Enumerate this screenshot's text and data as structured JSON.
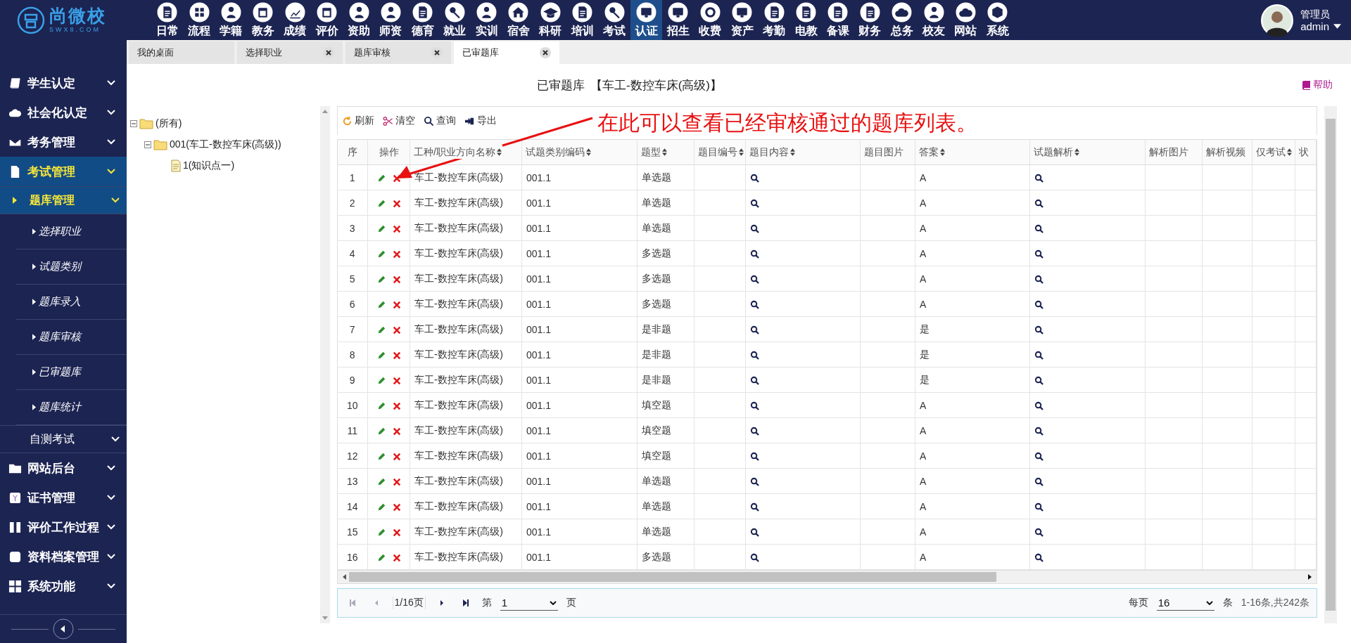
{
  "logo": {
    "name": "尚微校",
    "domain": "SWX8.COM"
  },
  "nav": [
    {
      "label": "日常",
      "selected": false
    },
    {
      "label": "流程",
      "selected": false
    },
    {
      "label": "学籍",
      "selected": false
    },
    {
      "label": "教务",
      "selected": false
    },
    {
      "label": "成绩",
      "selected": false
    },
    {
      "label": "评价",
      "selected": false
    },
    {
      "label": "资助",
      "selected": false
    },
    {
      "label": "师资",
      "selected": false
    },
    {
      "label": "德育",
      "selected": false
    },
    {
      "label": "就业",
      "selected": false
    },
    {
      "label": "实训",
      "selected": false
    },
    {
      "label": "宿舍",
      "selected": false
    },
    {
      "label": "科研",
      "selected": false
    },
    {
      "label": "培训",
      "selected": false
    },
    {
      "label": "考试",
      "selected": false
    },
    {
      "label": "认证",
      "selected": true
    },
    {
      "label": "招生",
      "selected": false
    },
    {
      "label": "收费",
      "selected": false
    },
    {
      "label": "资产",
      "selected": false
    },
    {
      "label": "考勤",
      "selected": false
    },
    {
      "label": "电教",
      "selected": false
    },
    {
      "label": "备课",
      "selected": false
    },
    {
      "label": "财务",
      "selected": false
    },
    {
      "label": "总务",
      "selected": false
    },
    {
      "label": "校友",
      "selected": false
    },
    {
      "label": "网站",
      "selected": false
    },
    {
      "label": "系统",
      "selected": false
    }
  ],
  "user": {
    "role": "管理员",
    "name": "admin"
  },
  "tabs": [
    {
      "label": "我的桌面",
      "closable": false,
      "selected": false
    },
    {
      "label": "选择职业",
      "closable": true,
      "selected": false
    },
    {
      "label": "题库审核",
      "closable": true,
      "selected": false
    },
    {
      "label": "已审题库",
      "closable": true,
      "selected": true
    }
  ],
  "sidebar": {
    "items": [
      {
        "label": "学生认定",
        "selected": false
      },
      {
        "label": "社会化认定",
        "selected": false
      },
      {
        "label": "考务管理",
        "selected": false
      },
      {
        "label": "考试管理",
        "selected": true,
        "children": [
          {
            "label": "题库管理",
            "selected": true,
            "children": [
              {
                "label": "选择职业"
              },
              {
                "label": "试题类别"
              },
              {
                "label": "题库录入"
              },
              {
                "label": "题库审核"
              },
              {
                "label": "已审题库"
              },
              {
                "label": "题库统计"
              }
            ]
          },
          {
            "label": "自测考试",
            "selected": false
          }
        ]
      },
      {
        "label": "网站后台",
        "selected": false
      },
      {
        "label": "证书管理",
        "selected": false
      },
      {
        "label": "评价工作过程",
        "selected": false
      },
      {
        "label": "资料档案管理",
        "selected": false
      },
      {
        "label": "系统功能",
        "selected": false
      }
    ]
  },
  "page": {
    "title": "已审题库",
    "subtitle": "【车工-数控车床(高级)】",
    "help": "帮助"
  },
  "tree": [
    {
      "label": "(所有)",
      "children": [
        {
          "label": "001(车工-数控车床(高级))",
          "children": [
            {
              "label": "1(知识点一)"
            }
          ]
        }
      ]
    }
  ],
  "toolbar": [
    "刷新",
    "清空",
    "查询",
    "导出"
  ],
  "annotation": "在此可以查看已经审核通过的题库列表。",
  "table": {
    "columns": [
      {
        "label": "序",
        "sortable": false
      },
      {
        "label": "操作",
        "sortable": false
      },
      {
        "label": "工种/职业方向名称",
        "sortable": true
      },
      {
        "label": "试题类别编码",
        "sortable": true
      },
      {
        "label": "题型",
        "sortable": true
      },
      {
        "label": "题目编号",
        "sortable": true
      },
      {
        "label": "题目内容",
        "sortable": true
      },
      {
        "label": "题目图片",
        "sortable": false
      },
      {
        "label": "答案",
        "sortable": true
      },
      {
        "label": "试题解析",
        "sortable": true
      },
      {
        "label": "解析图片",
        "sortable": false
      },
      {
        "label": "解析视频",
        "sortable": false
      },
      {
        "label": "仅考试",
        "sortable": true
      },
      {
        "label": "状",
        "sortable": false
      }
    ],
    "rows": [
      {
        "no": "1",
        "job": "车工-数控车床(高级)",
        "code": "001.1",
        "type": "单选题",
        "answer": "A"
      },
      {
        "no": "2",
        "job": "车工-数控车床(高级)",
        "code": "001.1",
        "type": "单选题",
        "answer": "A"
      },
      {
        "no": "3",
        "job": "车工-数控车床(高级)",
        "code": "001.1",
        "type": "单选题",
        "answer": "A"
      },
      {
        "no": "4",
        "job": "车工-数控车床(高级)",
        "code": "001.1",
        "type": "多选题",
        "answer": "A"
      },
      {
        "no": "5",
        "job": "车工-数控车床(高级)",
        "code": "001.1",
        "type": "多选题",
        "answer": "A"
      },
      {
        "no": "6",
        "job": "车工-数控车床(高级)",
        "code": "001.1",
        "type": "多选题",
        "answer": "A"
      },
      {
        "no": "7",
        "job": "车工-数控车床(高级)",
        "code": "001.1",
        "type": "是非题",
        "answer": "是"
      },
      {
        "no": "8",
        "job": "车工-数控车床(高级)",
        "code": "001.1",
        "type": "是非题",
        "answer": "是"
      },
      {
        "no": "9",
        "job": "车工-数控车床(高级)",
        "code": "001.1",
        "type": "是非题",
        "answer": "是"
      },
      {
        "no": "10",
        "job": "车工-数控车床(高级)",
        "code": "001.1",
        "type": "填空题",
        "answer": "A"
      },
      {
        "no": "11",
        "job": "车工-数控车床(高级)",
        "code": "001.1",
        "type": "填空题",
        "answer": "A"
      },
      {
        "no": "12",
        "job": "车工-数控车床(高级)",
        "code": "001.1",
        "type": "填空题",
        "answer": "A"
      },
      {
        "no": "13",
        "job": "车工-数控车床(高级)",
        "code": "001.1",
        "type": "单选题",
        "answer": "A"
      },
      {
        "no": "14",
        "job": "车工-数控车床(高级)",
        "code": "001.1",
        "type": "单选题",
        "answer": "A"
      },
      {
        "no": "15",
        "job": "车工-数控车床(高级)",
        "code": "001.1",
        "type": "单选题",
        "answer": "A"
      },
      {
        "no": "16",
        "job": "车工-数控车床(高级)",
        "code": "001.1",
        "type": "多选题",
        "answer": "A"
      }
    ]
  },
  "pager": {
    "pages": "1/16页",
    "page_prefix": "第",
    "page": "1",
    "page_suffix": "页",
    "per_page_label": "每页",
    "per_page": "16",
    "per_page_unit": "条",
    "summary": "1-16条,共242条"
  }
}
